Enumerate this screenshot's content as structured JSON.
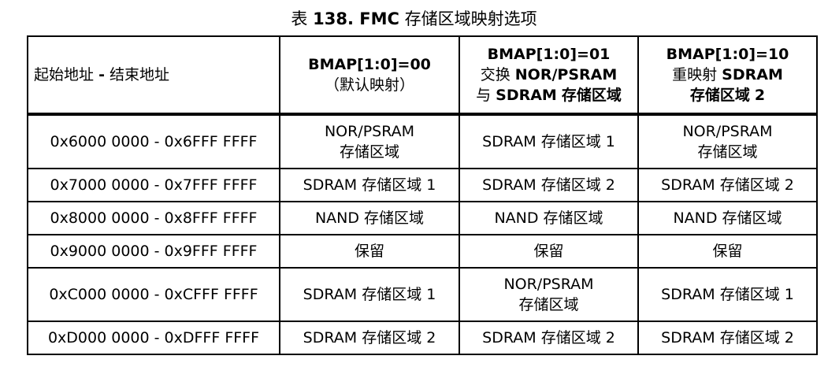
{
  "caption": {
    "prefix": "表",
    "number": "138. FMC",
    "suffix": "存储区域映射选项"
  },
  "header": {
    "range": {
      "pre": "起始地址",
      "sep": "-",
      "post": "结束地址"
    },
    "col1": {
      "line1": "BMAP[1:0]=00",
      "line2": "（默认映射）"
    },
    "col2": {
      "line1": "BMAP[1:0]=01",
      "line2_cjk": "交换",
      "line2_bold": "NOR/PSRAM",
      "line3_cjk1": "与",
      "line3_bold": "SDRAM",
      "line3_cjk2": "存储区域"
    },
    "col3": {
      "line1": "BMAP[1:0]=10",
      "line2_cjk": "重映射",
      "line2_bold": "SDRAM",
      "line3_cjk": "存储区域",
      "line3_bold": "2"
    }
  },
  "rows": [
    {
      "range": "0x6000 0000 - 0x6FFF FFFF",
      "c1": [
        "NOR/PSRAM",
        "存储区域"
      ],
      "c2": [
        "SDRAM 存储区域 1"
      ],
      "c3": [
        "NOR/PSRAM",
        "存储区域"
      ]
    },
    {
      "range": "0x7000 0000 - 0x7FFF FFFF",
      "c1": [
        "SDRAM 存储区域 1"
      ],
      "c2": [
        "SDRAM 存储区域 2"
      ],
      "c3": [
        "SDRAM 存储区域 2"
      ]
    },
    {
      "range": "0x8000 0000 - 0x8FFF FFFF",
      "c1": [
        "NAND 存储区域"
      ],
      "c2": [
        "NAND 存储区域"
      ],
      "c3": [
        "NAND 存储区域"
      ]
    },
    {
      "range": "0x9000 0000 - 0x9FFF FFFF",
      "c1": [
        "保留"
      ],
      "c2": [
        "保留"
      ],
      "c3": [
        "保留"
      ]
    },
    {
      "range": "0xC000 0000 - 0xCFFF FFFF",
      "c1": [
        "SDRAM 存储区域 1"
      ],
      "c2": [
        "NOR/PSRAM",
        "存储区域"
      ],
      "c3": [
        "SDRAM 存储区域 1"
      ]
    },
    {
      "range": "0xD000 0000 - 0xDFFF FFFF",
      "c1": [
        "SDRAM 存储区域 2"
      ],
      "c2": [
        "SDRAM 存储区域 2"
      ],
      "c3": [
        "SDRAM 存储区域 2"
      ]
    }
  ]
}
